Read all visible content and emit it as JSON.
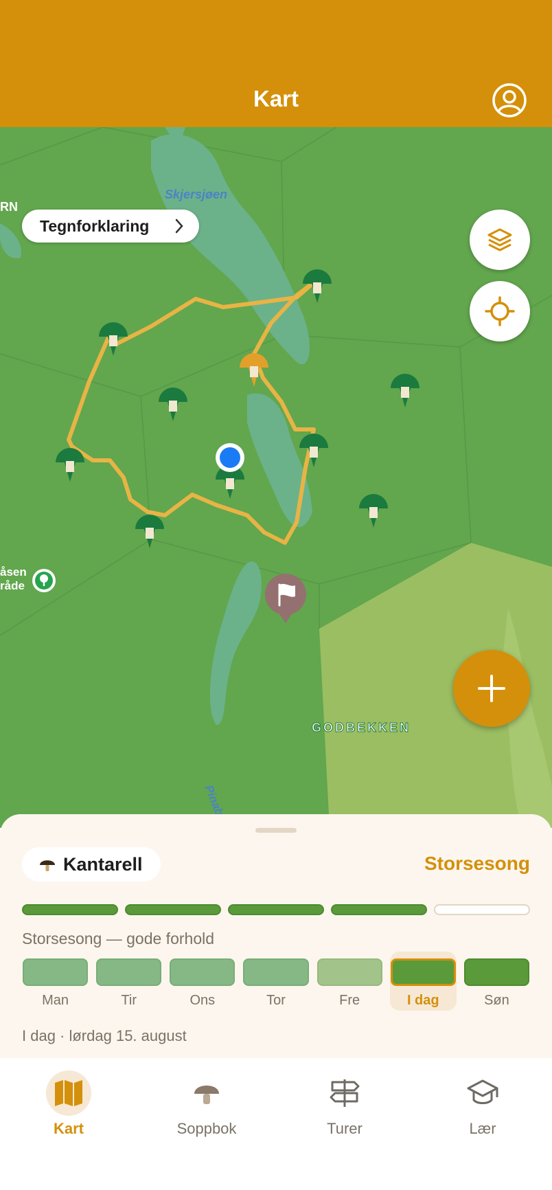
{
  "header": {
    "title": "Kart"
  },
  "map": {
    "legend_label": "Tegnforklaring",
    "labels": {
      "lake": "Skjersjøen",
      "area": "GODBEKKEN",
      "river": "Pinabe",
      "edge": "RN",
      "area_left_1": "åsen",
      "area_left_2": "råde"
    },
    "layers_icon": "layers-icon",
    "locate_icon": "crosshair-icon",
    "add_icon": "plus-icon"
  },
  "sheet": {
    "species": "Kantarell",
    "season_label": "Storsesong",
    "season_level": {
      "filled": 4,
      "total": 5
    },
    "season_description": "Storsesong — gode forhold",
    "days": [
      {
        "label": "Man",
        "color": "#86B886"
      },
      {
        "label": "Tir",
        "color": "#86B886"
      },
      {
        "label": "Ons",
        "color": "#86B886"
      },
      {
        "label": "Tor",
        "color": "#86B886"
      },
      {
        "label": "Fre",
        "color": "#A2C48A"
      },
      {
        "label": "I dag",
        "color": "#5A9A3A",
        "today": true
      },
      {
        "label": "Søn",
        "color": "#5A9A3A"
      }
    ],
    "date_line": "I dag · lørdag 15. august"
  },
  "tabs": [
    {
      "label": "Kart",
      "icon": "map-icon",
      "active": true
    },
    {
      "label": "Soppbok",
      "icon": "mushroom-icon"
    },
    {
      "label": "Turer",
      "icon": "signpost-icon"
    },
    {
      "label": "Lær",
      "icon": "graduation-cap-icon"
    }
  ],
  "colors": {
    "accent": "#D4900A",
    "map_green": "#62A64E",
    "route": "#E8B445",
    "pin_green": "#1B7A3E"
  }
}
